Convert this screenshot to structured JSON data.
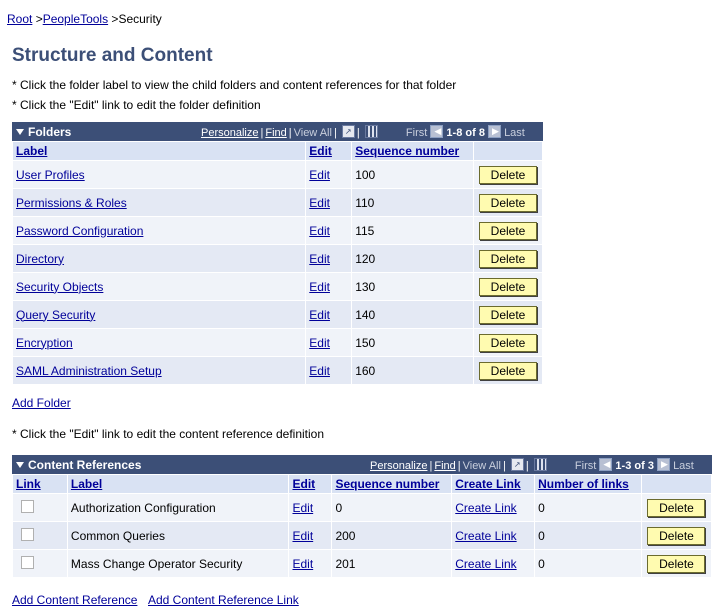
{
  "breadcrumb": {
    "root": "Root",
    "sep1": " >",
    "peopletools": "PeopleTools",
    "sep2": " >",
    "current": "Security"
  },
  "page_title": "Structure and Content",
  "instructions": {
    "line1": "* Click the folder label to view the child folders and content references for that folder",
    "line2": "* Click the \"Edit\" link to edit the folder definition",
    "line3": "* Click the \"Edit\" link to edit the content reference definition"
  },
  "folders": {
    "title": "Folders",
    "personalize": "Personalize",
    "find": "Find",
    "view_all": "View All",
    "first": "First",
    "range": "1-8 of 8",
    "last": "Last",
    "columns": [
      "Label",
      "Edit",
      "Sequence number",
      ""
    ],
    "rows": [
      {
        "label": "User Profiles",
        "edit": "Edit",
        "seq": "100",
        "delete": "Delete"
      },
      {
        "label": "Permissions & Roles",
        "edit": "Edit",
        "seq": "110",
        "delete": "Delete"
      },
      {
        "label": "Password Configuration",
        "edit": "Edit",
        "seq": "115",
        "delete": "Delete"
      },
      {
        "label": "Directory",
        "edit": "Edit",
        "seq": "120",
        "delete": "Delete"
      },
      {
        "label": "Security Objects",
        "edit": "Edit",
        "seq": "130",
        "delete": "Delete"
      },
      {
        "label": "Query Security",
        "edit": "Edit",
        "seq": "140",
        "delete": "Delete"
      },
      {
        "label": "Encryption",
        "edit": "Edit",
        "seq": "150",
        "delete": "Delete"
      },
      {
        "label": "SAML Administration Setup",
        "edit": "Edit",
        "seq": "160",
        "delete": "Delete"
      }
    ],
    "add_label": "Add Folder"
  },
  "content_refs": {
    "title": "Content References",
    "personalize": "Personalize",
    "find": "Find",
    "view_all": "View All",
    "first": "First",
    "range": "1-3 of 3",
    "last": "Last",
    "columns": [
      "Link",
      "Label",
      "Edit",
      "Sequence number",
      "Create Link",
      "Number of links",
      ""
    ],
    "rows": [
      {
        "label": "Authorization Configuration",
        "edit": "Edit",
        "seq": "0",
        "create_link": "Create Link",
        "num_links": "0",
        "delete": "Delete"
      },
      {
        "label": "Common Queries",
        "edit": "Edit",
        "seq": "200",
        "create_link": "Create Link",
        "num_links": "0",
        "delete": "Delete"
      },
      {
        "label": "Mass Change Operator Security",
        "edit": "Edit",
        "seq": "201",
        "create_link": "Create Link",
        "num_links": "0",
        "delete": "Delete"
      }
    ],
    "add_ref_label": "Add Content Reference",
    "add_ref_link_label": "Add Content Reference Link"
  },
  "colors": {
    "header_bar": "#3c4f77",
    "title": "#3c4f77",
    "link": "#000099",
    "button": "#fffbb0",
    "row_light": "#f0f3f9",
    "row_dark": "#e4e9f4"
  }
}
